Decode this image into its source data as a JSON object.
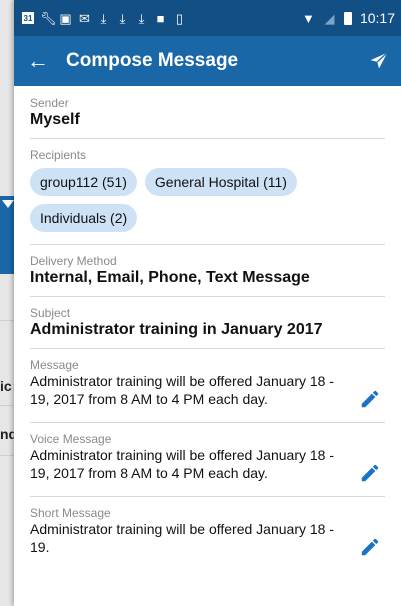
{
  "status_bar": {
    "calendar_day": "31",
    "time": "10:17"
  },
  "app_bar": {
    "title": "Compose Message",
    "back_icon": "arrow-back-icon",
    "send_icon": "send-icon"
  },
  "background": {
    "row1_text": "ic",
    "row2_text": "nd"
  },
  "form": {
    "sender": {
      "label": "Sender",
      "value": "Myself"
    },
    "recipients": {
      "label": "Recipients",
      "chips": [
        "group112 (51)",
        "General Hospital (11)",
        "Individuals (2)"
      ]
    },
    "delivery": {
      "label": "Delivery Method",
      "value": "Internal, Email, Phone, Text Message"
    },
    "subject": {
      "label": "Subject",
      "value": "Administrator training in January 2017"
    },
    "message": {
      "label": "Message",
      "value": "Administrator training will be offered January 18 - 19, 2017 from 8 AM to 4 PM each day."
    },
    "voice_message": {
      "label": "Voice Message",
      "value": "Administrator training will be offered January 18 - 19, 2017 from 8 AM to 4 PM each day."
    },
    "short_message": {
      "label": "Short Message",
      "value": "Administrator training will be offered January 18 - 19."
    }
  },
  "colors": {
    "status_bar": "#114f84",
    "app_bar": "#1a67a8",
    "chip": "#cde3f5",
    "edit_icon": "#1a73c7"
  }
}
